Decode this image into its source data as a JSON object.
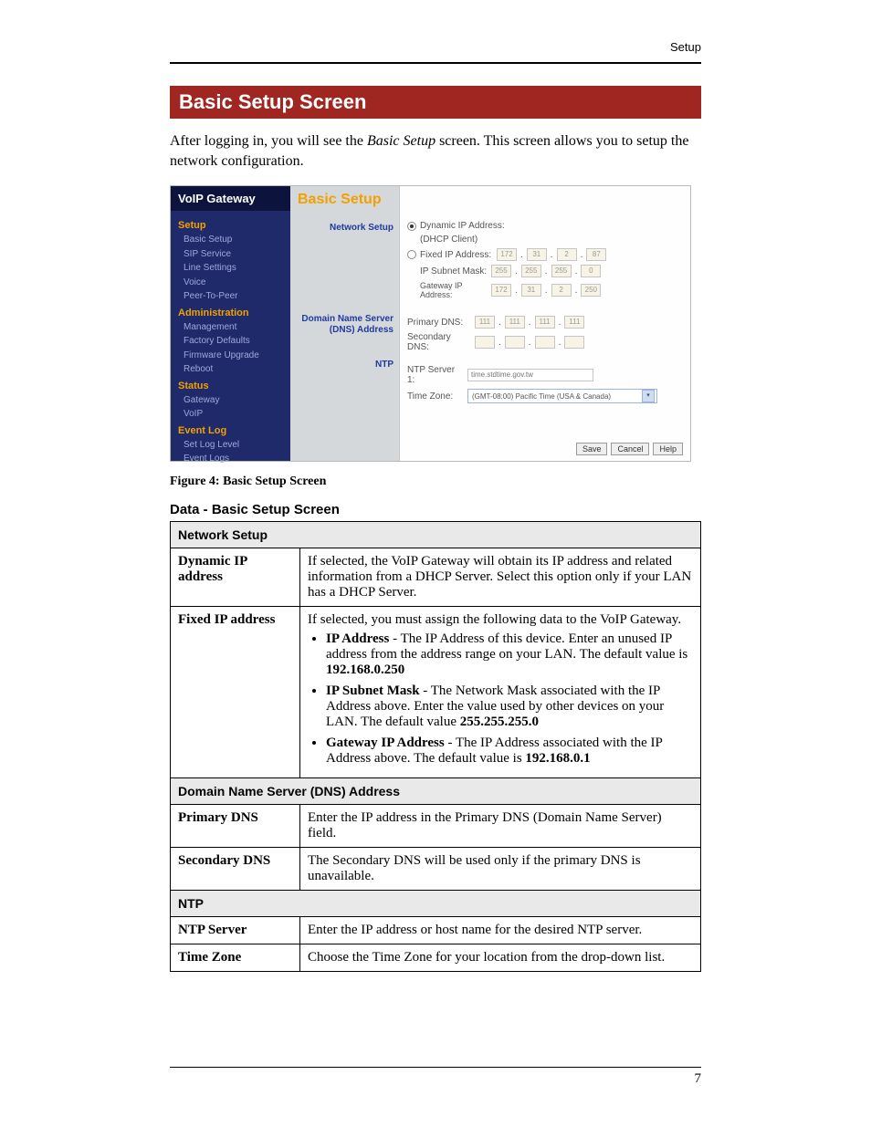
{
  "page": {
    "top_right_label": "Setup",
    "number": "7",
    "section_bar": "Basic Setup Screen",
    "intro_pre": "After logging in, you will see the ",
    "intro_ital": "Basic Setup",
    "intro_post": " screen. This screen allows you to setup the network configuration.",
    "figure_caption": "Figure 4: Basic Setup Screen",
    "data_title": "Data - Basic Setup Screen"
  },
  "shot": {
    "voip_header": "VoIP Gateway",
    "basic_setup": "Basic Setup",
    "nav": {
      "g1_title": "Setup",
      "g1": [
        "Basic Setup",
        "SIP Service",
        "Line Settings",
        "Voice",
        "Peer-To-Peer"
      ],
      "g2_title": "Administration",
      "g2": [
        "Management",
        "Factory Defaults",
        "Firmware Upgrade",
        "Reboot"
      ],
      "g3_title": "Status",
      "g3": [
        "Gateway",
        "VoIP"
      ],
      "g4_title": "Event Log",
      "g4": [
        "Set Log Level",
        "Event Logs"
      ]
    },
    "labels": {
      "network_setup": "Network Setup",
      "dns": "Domain Name Server (DNS) Address",
      "ntp": "NTP"
    },
    "form": {
      "dyn_ip": "Dynamic IP Address:",
      "dhcp": "(DHCP Client)",
      "fixed_ip": "Fixed IP Address:",
      "subnet": "IP Subnet Mask:",
      "gw": "Gateway IP Address:",
      "ip_oct": {
        "a": "172",
        "b": "31",
        "c": "2",
        "d": "87"
      },
      "mask_oct": {
        "a": "255",
        "b": "255",
        "c": "255",
        "d": "0"
      },
      "gw_oct": {
        "a": "172",
        "b": "31",
        "c": "2",
        "d": "250"
      },
      "pdns": "Primary DNS:",
      "pdns_oct": {
        "a": "111",
        "b": "111",
        "c": "111",
        "d": "111"
      },
      "sdns": "Secondary DNS:",
      "ntp1": "NTP Server 1:",
      "ntp1_val": "time.stdtime.gov.tw",
      "tz": "Time Zone:",
      "tz_val": "(GMT-08:00) Pacific Time (USA & Canada)",
      "btn_save": "Save",
      "btn_cancel": "Cancel",
      "btn_help": "Help"
    }
  },
  "table": {
    "sec1": "Network Setup",
    "r1_label": "Dynamic IP address",
    "r1_text": "If selected, the VoIP Gateway will obtain its IP address and related information from a DHCP Server. Select this option only if your LAN has a DHCP Server.",
    "r2_label": "Fixed IP address",
    "r2_intro": "If selected, you must assign the following data to the VoIP Gateway.",
    "r2_b1_pre": "IP Address",
    "r2_b1_post": " - The IP Address of this device. Enter an unused IP address from the address range on your LAN. The default value is ",
    "r2_b1_val": "192.168.0.250",
    "r2_b2_pre": "IP Subnet Mask",
    "r2_b2_post": " - The Network Mask associated with the IP Address above. Enter the value used by other devices on your LAN. The default value ",
    "r2_b2_val": "255.255.255.0",
    "r2_b3_pre": "Gateway IP Address",
    "r2_b3_post": " - The IP Address associated with the IP Address above. The default value is ",
    "r2_b3_val": "192.168.0.1",
    "sec2": "Domain Name Server (DNS) Address",
    "r3_label": "Primary DNS",
    "r3_text": "Enter the IP address in the Primary DNS (Domain Name Server) field.",
    "r4_label": "Secondary DNS",
    "r4_text": "The Secondary DNS will be used only if the primary DNS is unavailable.",
    "sec3": "NTP",
    "r5_label": "NTP Server",
    "r5_text": "Enter the IP address or host name for the desired NTP server.",
    "r6_label": "Time Zone",
    "r6_text": "Choose the Time Zone for your location from the drop-down list."
  }
}
